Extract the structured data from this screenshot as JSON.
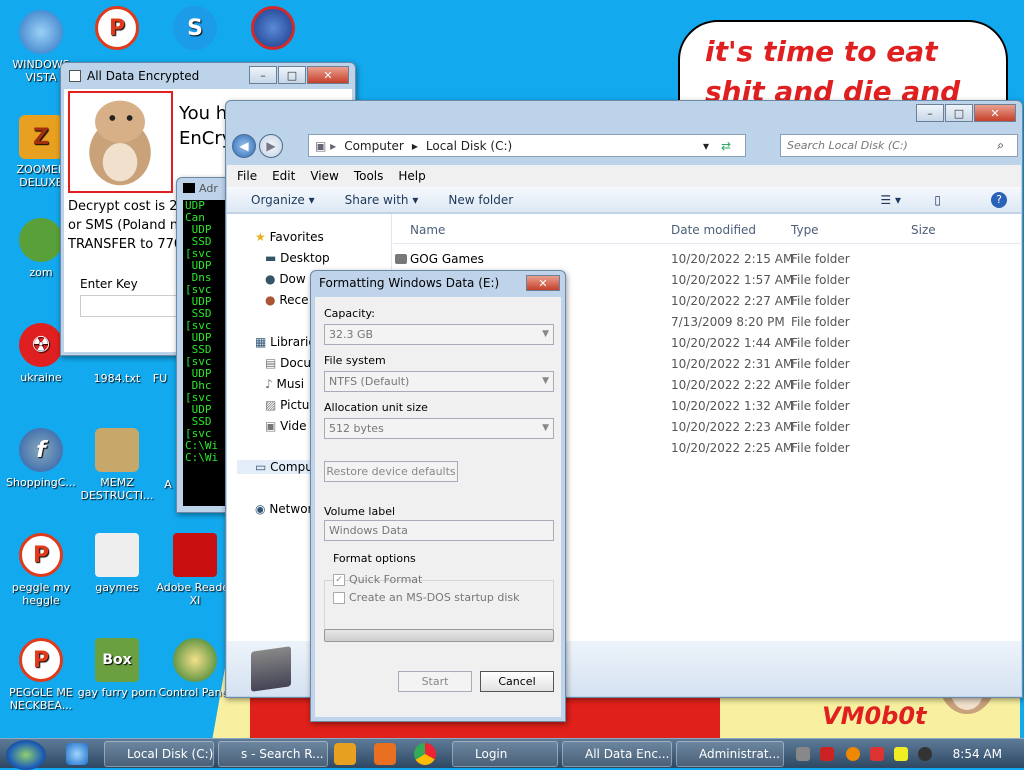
{
  "wallpaper": {
    "speech": "it's time to eat shit and die and chew",
    "signature": "VM0b0t"
  },
  "desktop_icons": [
    {
      "label": "WINDOWS VISTA",
      "color": "#3a8fd8",
      "glyph": ""
    },
    {
      "label": "ZOOMER DELUXE",
      "color": "#e8a020",
      "glyph": "Z"
    },
    {
      "label": "zom",
      "color": "#57a33a",
      "glyph": ""
    },
    {
      "label": "ukraine",
      "color": "#e02020",
      "glyph": "☢"
    },
    {
      "label": "ShoppingC...",
      "color": "#2a5caa",
      "glyph": "f"
    },
    {
      "label": "peggle my heggle",
      "color": "#e03a1a",
      "glyph": "P"
    },
    {
      "label": "PEGGLE ME NECKBEA...",
      "color": "#e03a1a",
      "glyph": "P"
    },
    {
      "label": "",
      "color": "#e03a1a",
      "glyph": "P"
    },
    {
      "label": "",
      "color": "#1b9be8",
      "glyph": "S"
    },
    {
      "label": "",
      "color": "#d02a2a",
      "glyph": ""
    },
    {
      "label": "1984.txt",
      "color": "#ffffff",
      "glyph": ""
    },
    {
      "label": "MEMZ DESTRUCTI...",
      "color": "#c8a86a",
      "glyph": ""
    },
    {
      "label": "gaymes",
      "color": "#ffffff",
      "glyph": ""
    },
    {
      "label": "gay furry porn",
      "color": "#6aa040",
      "glyph": "Box"
    },
    {
      "label": "Adobe Reader XI",
      "color": "#c81010",
      "glyph": ""
    },
    {
      "label": "Control Panel",
      "color": "#2a7a2a",
      "glyph": ""
    },
    {
      "label": "FU",
      "color": "#ffffff",
      "glyph": ""
    },
    {
      "label": "A",
      "color": "#ffffff",
      "glyph": ""
    }
  ],
  "encrypt_window": {
    "title": "All Data Encrypted",
    "headline_1": "You h",
    "headline_2": "EnCry",
    "line_1": "Decrypt cost is 29",
    "line_2": "or SMS (Poland n",
    "line_3": "TRANSFER to 770",
    "key_label": "Enter Key"
  },
  "cmd_window": {
    "title": "Adr",
    "lines": [
      "UDP",
      "Can",
      " UDP",
      " SSD",
      "[svc",
      " UDP",
      " Dns",
      "[svc",
      " UDP",
      " SSD",
      "[svc",
      " UDP",
      " SSD",
      "[svc",
      " UDP",
      " Dhc",
      "[svc",
      " UDP",
      " SSD",
      "[svc",
      "",
      "C:\\Wi",
      "",
      "C:\\Wi"
    ]
  },
  "explorer": {
    "address": [
      "Computer",
      "Local Disk (C:)"
    ],
    "search_placeholder": "Search Local Disk (C:)",
    "menu": [
      "File",
      "Edit",
      "View",
      "Tools",
      "Help"
    ],
    "commands": [
      "Organize ▾",
      "Share with ▾",
      "New folder"
    ],
    "nav": [
      "Favorites",
      "Desktop",
      "Dow",
      "Rece",
      "Librarie",
      "Docu",
      "Musi",
      "Pictu",
      "Vide",
      "Compu",
      "Networ"
    ],
    "columns": {
      "name": "Name",
      "date": "Date modified",
      "type": "Type",
      "size": "Size"
    },
    "rows": [
      {
        "name": "GOG Games",
        "date": "10/20/2022 2:15 AM",
        "type": "File folder"
      },
      {
        "name": "",
        "date": "10/20/2022 1:57 AM",
        "type": "File folder"
      },
      {
        "name": "",
        "date": "10/20/2022 2:27 AM",
        "type": "File folder"
      },
      {
        "name": "",
        "date": "7/13/2009 8:20 PM",
        "type": "File folder"
      },
      {
        "name": "",
        "date": "10/20/2022 1:44 AM",
        "type": "File folder"
      },
      {
        "name": "",
        "date": "10/20/2022 2:31 AM",
        "type": "File folder"
      },
      {
        "name": "",
        "date": "10/20/2022 2:22 AM",
        "type": "File folder"
      },
      {
        "name": "",
        "date": "10/20/2022 1:32 AM",
        "type": "File folder"
      },
      {
        "name": "",
        "date": "10/20/2022 2:23 AM",
        "type": "File folder"
      },
      {
        "name": "",
        "date": "10/20/2022 2:25 AM",
        "type": "File folder"
      }
    ]
  },
  "format_dialog": {
    "title": "Formatting Windows Data (E:)",
    "capacity_label": "Capacity:",
    "capacity_value": "32.3 GB",
    "filesystem_label": "File system",
    "filesystem_value": "NTFS (Default)",
    "alloc_label": "Allocation unit size",
    "alloc_value": "512 bytes",
    "restore_btn": "Restore device defaults",
    "volume_label": "Volume label",
    "volume_value": "Windows Data",
    "options_label": "Format options",
    "quick_format": "Quick Format",
    "msdos": "Create an MS-DOS startup disk",
    "start_btn": "Start",
    "cancel_btn": "Cancel"
  },
  "taskbar": {
    "items": [
      "Local Disk (C:)",
      "s - Search R...",
      "Login",
      "All Data Enc...",
      "Administrat..."
    ],
    "clock": "8:54 AM"
  }
}
